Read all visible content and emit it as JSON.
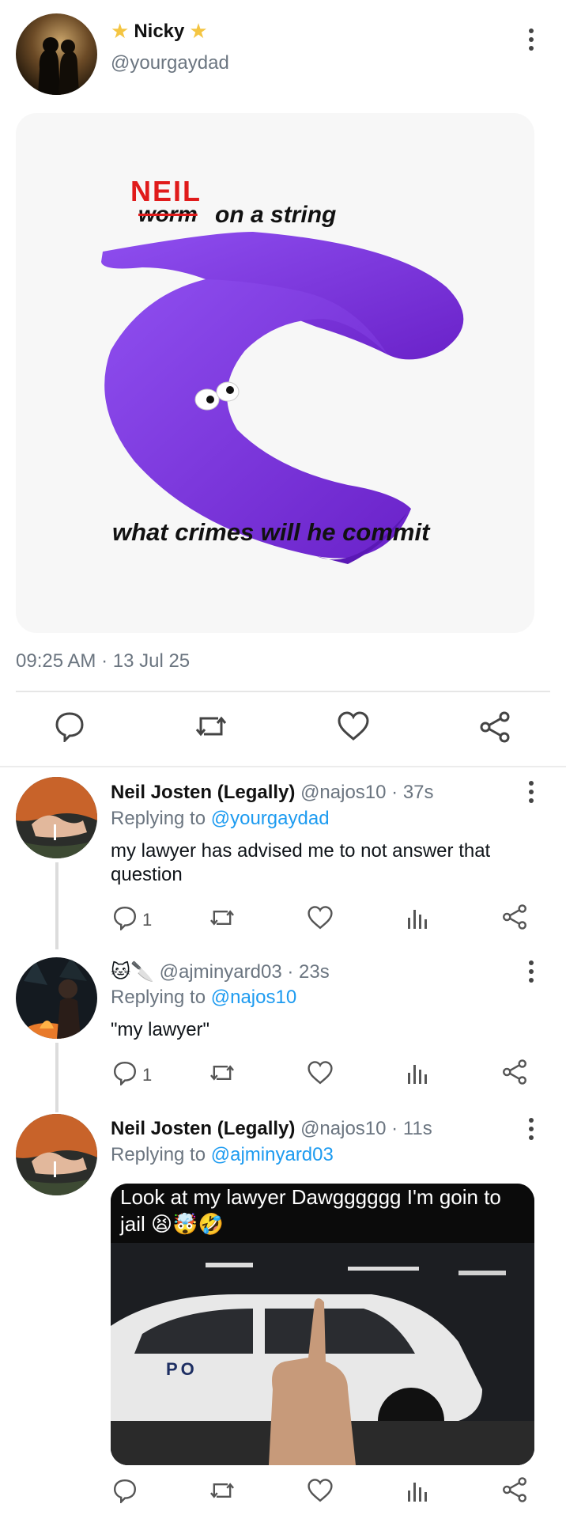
{
  "original_tweet": {
    "display_name": "Nicky",
    "handle": "@yourgaydad",
    "timestamp": "09:25 AM · 13 Jul 25",
    "image": {
      "handwritten_word": "NEIL",
      "struck_word": "worm",
      "title_rest": "on a string",
      "caption": "what crimes will he commit"
    }
  },
  "replies": [
    {
      "display_name": "Neil Josten (Legally)",
      "handle": "@najos10",
      "time": "· 37s",
      "replying_to_label": "Replying to",
      "replying_to": "@yourgaydad",
      "text": "my lawyer has advised me to not answer that question",
      "reply_count": "1"
    },
    {
      "display_name": "🐱🔪",
      "handle": "@ajminyard03",
      "time": "· 23s",
      "replying_to_label": "Replying to",
      "replying_to": "@najos10",
      "text": "\"my lawyer\"",
      "reply_count": "1"
    },
    {
      "display_name": "Neil Josten (Legally)",
      "handle": "@najos10",
      "time": "· 11s",
      "replying_to_label": "Replying to",
      "replying_to": "@ajminyard03",
      "image_caption": "Look at my lawyer Dawgggggg I'm goin to jail 😫🤯🤣",
      "image_police_text": "PO"
    }
  ],
  "icons": [
    "reply-icon",
    "retweet-icon",
    "like-icon",
    "views-icon",
    "share-icon",
    "more-options-icon"
  ],
  "colors": {
    "link": "#1d9bf0",
    "muted": "#6b7580",
    "worm": "#7a2fd6"
  }
}
